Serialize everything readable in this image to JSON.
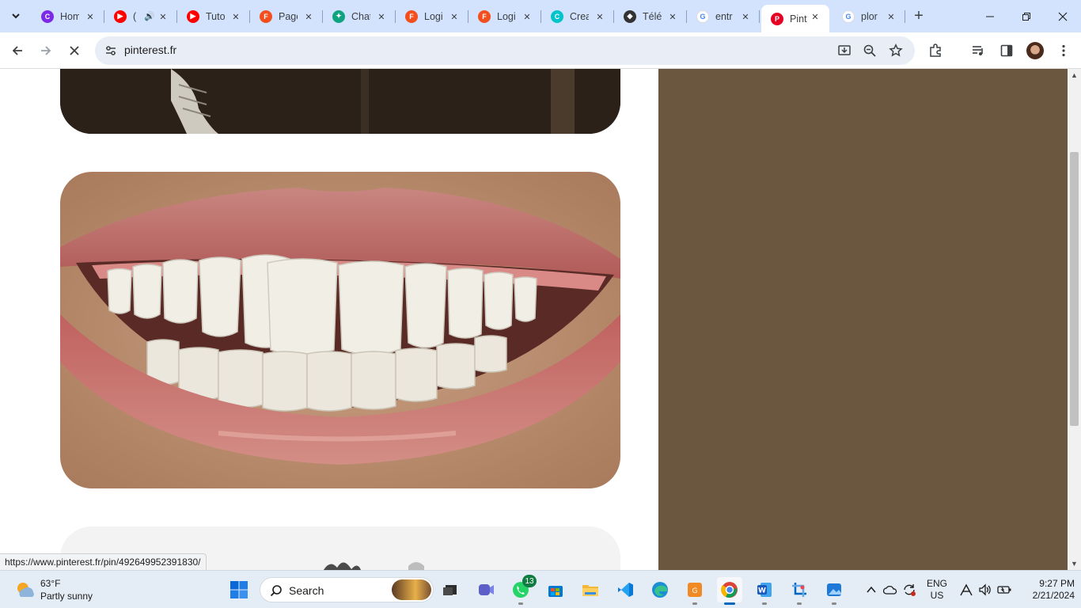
{
  "browser": {
    "tabs": [
      {
        "title": "Home",
        "favicon": "canva-favicon",
        "color": "#7d2ae8",
        "active": false
      },
      {
        "title": "(",
        "favicon": "youtube-favicon",
        "color": "#ff0000",
        "audio": true,
        "active": false
      },
      {
        "title": "Tuto",
        "favicon": "youtube-favicon",
        "color": "#ff0000",
        "active": false
      },
      {
        "title": "Page",
        "favicon": "figma-favicon",
        "color": "#f24e1e",
        "active": false
      },
      {
        "title": "Chat",
        "favicon": "chatgpt-favicon",
        "color": "#10a37f",
        "active": false
      },
      {
        "title": "Logi",
        "favicon": "figma-favicon",
        "color": "#f24e1e",
        "active": false
      },
      {
        "title": "Logi",
        "favicon": "figma-favicon",
        "color": "#f24e1e",
        "active": false
      },
      {
        "title": "Crea",
        "favicon": "canva-favicon",
        "color": "#00c4cc",
        "active": false
      },
      {
        "title": "Télé",
        "favicon": "graduation-cap-favicon",
        "color": "#333333",
        "active": false
      },
      {
        "title": "entr",
        "favicon": "google-favicon",
        "color": "#4285f4",
        "active": false
      },
      {
        "title": "Pint",
        "favicon": "pinterest-favicon",
        "color": "#e60023",
        "active": true
      },
      {
        "title": "plor",
        "favicon": "google-favicon",
        "color": "#4285f4",
        "active": false
      }
    ],
    "address": "pinterest.fr"
  },
  "page": {
    "hover_link": "https://www.pinterest.fr/pin/492649952391830/",
    "side_panel_color": "#6b5740"
  },
  "taskbar": {
    "weather_temp": "63°F",
    "weather_condition": "Partly sunny",
    "search_label": "Search",
    "whatsapp_badge": "13",
    "language_top": "ENG",
    "language_bottom": "US",
    "time": "9:27 PM",
    "date": "2/21/2024"
  }
}
